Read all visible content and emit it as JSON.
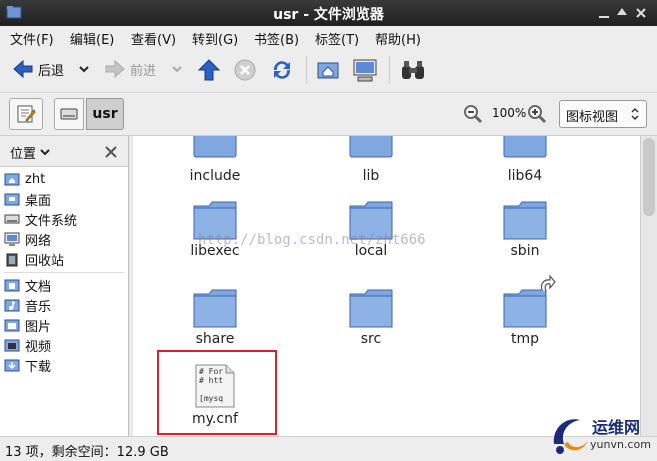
{
  "window": {
    "title": "usr - 文件浏览器"
  },
  "menu": [
    "文件(F)",
    "编辑(E)",
    "查看(V)",
    "转到(G)",
    "书签(B)",
    "标签(T)",
    "帮助(H)"
  ],
  "toolbar": {
    "back_label": "后退",
    "forward_label": "前进"
  },
  "location": {
    "current": "usr",
    "zoom": "100%",
    "view_mode": "图标视图"
  },
  "sidebar": {
    "header": "位置",
    "places": [
      {
        "label": "zht",
        "icon": "home-folder-icon"
      },
      {
        "label": "桌面",
        "icon": "desktop-folder-icon"
      },
      {
        "label": "文件系统",
        "icon": "filesystem-icon"
      },
      {
        "label": "网络",
        "icon": "network-icon"
      },
      {
        "label": "回收站",
        "icon": "trash-icon"
      }
    ],
    "bookmarks": [
      {
        "label": "文档",
        "icon": "documents-folder-icon"
      },
      {
        "label": "音乐",
        "icon": "music-folder-icon"
      },
      {
        "label": "图片",
        "icon": "pictures-folder-icon"
      },
      {
        "label": "视频",
        "icon": "videos-folder-icon"
      },
      {
        "label": "下载",
        "icon": "downloads-folder-icon"
      }
    ]
  },
  "files": [
    {
      "name": "include",
      "type": "folder"
    },
    {
      "name": "lib",
      "type": "folder"
    },
    {
      "name": "lib64",
      "type": "folder"
    },
    {
      "name": "libexec",
      "type": "folder"
    },
    {
      "name": "local",
      "type": "folder"
    },
    {
      "name": "sbin",
      "type": "folder"
    },
    {
      "name": "share",
      "type": "folder"
    },
    {
      "name": "src",
      "type": "folder"
    },
    {
      "name": "tmp",
      "type": "folder-link"
    },
    {
      "name": "my.cnf",
      "type": "text-file",
      "preview": [
        "# For",
        "# htt",
        "",
        "[mysq"
      ]
    }
  ],
  "status": "13 项，剩余空间：12.9 GB",
  "watermark": "http://blog.csdn.net/zht666",
  "logo": {
    "name": "运维网",
    "domain": "yunvn.com"
  },
  "colors": {
    "folder": "#7fa8e0",
    "highlight": "#e02020",
    "accent": "#2a62c4"
  }
}
